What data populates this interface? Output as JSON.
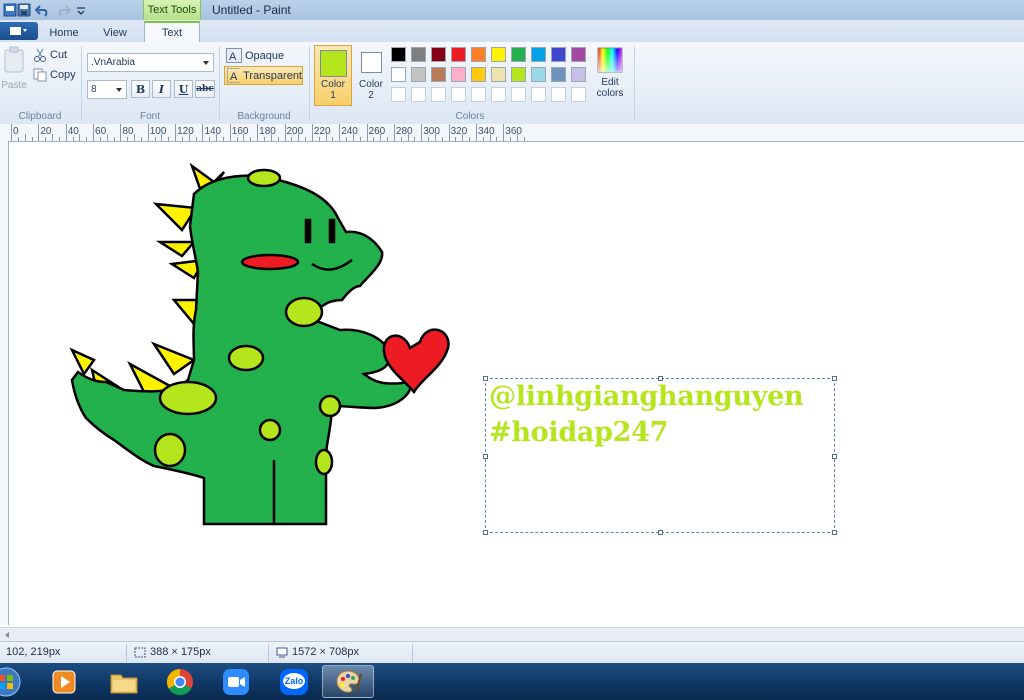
{
  "titlebar": {
    "context_tab": "Text Tools",
    "window_title": "Untitled - Paint"
  },
  "tabs": [
    {
      "label": "Home"
    },
    {
      "label": "View"
    },
    {
      "label": "Text",
      "active": true
    }
  ],
  "clipboard": {
    "paste": "Paste",
    "cut": "Cut",
    "copy": "Copy",
    "group": "Clipboard"
  },
  "font": {
    "family": ".VnArabia",
    "size": "8",
    "bold": "B",
    "italic": "I",
    "underline": "U",
    "strike": "abc",
    "group": "Font"
  },
  "background": {
    "opaque": "Opaque",
    "transparent": "Transparent",
    "group": "Background"
  },
  "colors": {
    "color1_label": "Color\n1",
    "color1_line1": "Color",
    "color1_line2": "1",
    "color2_line1": "Color",
    "color2_line2": "2",
    "color1_value": "#b5e61d",
    "color2_value": "#ffffff",
    "edit_line1": "Edit",
    "edit_line2": "colors",
    "group": "Colors",
    "palette_row1": [
      "#000000",
      "#7f7f7f",
      "#880015",
      "#ed1c24",
      "#ff7f27",
      "#fff200",
      "#22b14c",
      "#00a2e8",
      "#3f48cc",
      "#a349a4"
    ],
    "palette_row2": [
      "#ffffff",
      "#c3c3c3",
      "#b97a57",
      "#ffaec9",
      "#ffc90e",
      "#efe4b0",
      "#b5e61d",
      "#99d9ea",
      "#7092be",
      "#c8bfe7"
    ]
  },
  "ruler": {
    "labels": [
      "0",
      "20",
      "40",
      "60",
      "80",
      "100",
      "120",
      "140",
      "160",
      "180",
      "200",
      "220",
      "240",
      "260",
      "280",
      "300",
      "320",
      "340",
      "360"
    ]
  },
  "canvas_text": {
    "line1": "@linhgianghanguyen",
    "line2": "#hoidap247",
    "color": "#b5e61d"
  },
  "status": {
    "cursor_pos": "102, 219px",
    "selection_size": "388 × 175px",
    "image_size": "1572 × 708px"
  },
  "taskbar": {
    "items": [
      {
        "name": "start-orb"
      },
      {
        "name": "media-player"
      },
      {
        "name": "file-explorer"
      },
      {
        "name": "chrome"
      },
      {
        "name": "zoom"
      },
      {
        "name": "zalo",
        "label": "Zalo"
      },
      {
        "name": "paint",
        "active": true
      }
    ]
  }
}
